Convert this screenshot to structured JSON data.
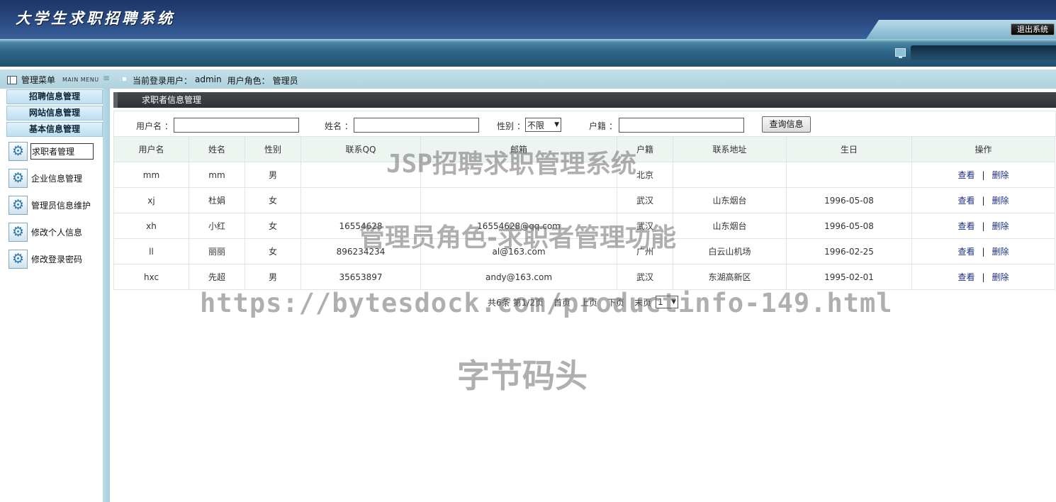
{
  "header": {
    "title": "大学生求职招聘系统",
    "logout_label": "退出系统"
  },
  "subbar": {
    "menu_label": "管理菜单",
    "menu_en": "MAIN MENU",
    "user_prefix": "当前登录用户：",
    "user_name": "admin",
    "role_prefix": "用户角色：",
    "role_name": "管理员"
  },
  "sidebar": {
    "categories": [
      "招聘信息管理",
      "网站信息管理",
      "基本信息管理"
    ],
    "items": [
      "求职者管理",
      "企业信息管理",
      "管理员信息维护",
      "修改个人信息",
      "修改登录密码"
    ],
    "icon": "gear-icon"
  },
  "panel": {
    "title": "求职者信息管理"
  },
  "search": {
    "username_label": "用户名 ：",
    "name_label": "姓名 ：",
    "gender_label": "性别 ：",
    "gender_selected": "不限",
    "hukou_label": "户籍 ：",
    "search_button": "查询信息"
  },
  "table": {
    "headers": [
      "用户名",
      "姓名",
      "性别",
      "联系QQ",
      "邮箱",
      "户籍",
      "联系地址",
      "生日",
      "操作"
    ],
    "rows": [
      [
        "mm",
        "mm",
        "男",
        "",
        "",
        "北京",
        "",
        ""
      ],
      [
        "xj",
        "杜娟",
        "女",
        "",
        "",
        "武汉",
        "山东烟台",
        "1996-05-08"
      ],
      [
        "xh",
        "小红",
        "女",
        "16554628",
        "16554628@qq.com",
        "武汉",
        "山东烟台",
        "1996-05-08"
      ],
      [
        "ll",
        "丽丽",
        "女",
        "896234234",
        "al@163.com",
        "广州",
        "白云山机场",
        "1996-02-25"
      ],
      [
        "hxc",
        "先超",
        "男",
        "35653897",
        "andy@163.com",
        "武汉",
        "东湖高新区",
        "1995-02-01"
      ]
    ],
    "view_label": "查看",
    "sep": "|",
    "delete_label": "删除"
  },
  "pager": {
    "total": "共6条",
    "page_info": "第1/2页",
    "first": "首页",
    "prev": "上页",
    "next": "下页",
    "last": "末页",
    "selected": "1"
  },
  "watermarks": {
    "line1": "JSP招聘求职管理系统",
    "line2": "管理员角色-求职者管理功能",
    "line3": "https://bytesdock.com/productinfo-149.html",
    "line4": "字节码头"
  }
}
